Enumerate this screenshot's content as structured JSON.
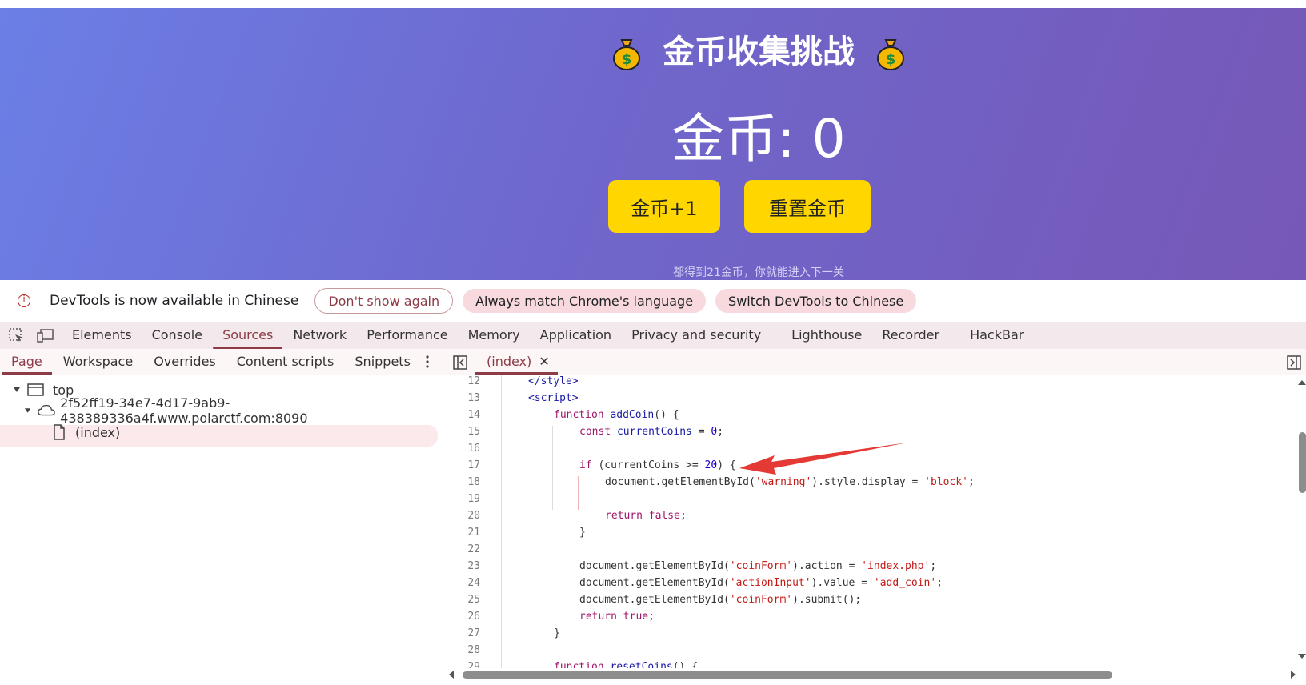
{
  "game": {
    "title": "金币收集挑战",
    "coin_label": "金币: 0",
    "add_button": "金币+1",
    "reset_button": "重置金币",
    "hint": "都得到21金币，你就能进入下一关"
  },
  "banner": {
    "message": "DevTools is now available in Chinese",
    "dont_show": "Don't show again",
    "match_language": "Always match Chrome's language",
    "switch": "Switch DevTools to Chinese"
  },
  "tabs": [
    "Elements",
    "Console",
    "Sources",
    "Network",
    "Performance",
    "Memory",
    "Application",
    "Privacy and security",
    "Lighthouse",
    "Recorder",
    "HackBar"
  ],
  "subtabs": [
    "Page",
    "Workspace",
    "Overrides",
    "Content scripts",
    "Snippets"
  ],
  "tree": {
    "top": "top",
    "origin": "2f52ff19-34e7-4d17-9ab9-438389336a4f.www.polarctf.com:8090",
    "file": "(index)"
  },
  "editor": {
    "file_tab": "(index)"
  },
  "code": {
    "line_numbers": [
      "12",
      "13",
      "14",
      "15",
      "16",
      "17",
      "18",
      "19",
      "20",
      "21",
      "22",
      "23",
      "24",
      "25",
      "26",
      "27",
      "28",
      "29"
    ]
  },
  "colors": {
    "accent": "#8c3b47",
    "button": "#ffd600",
    "arrow": "#e53935"
  }
}
